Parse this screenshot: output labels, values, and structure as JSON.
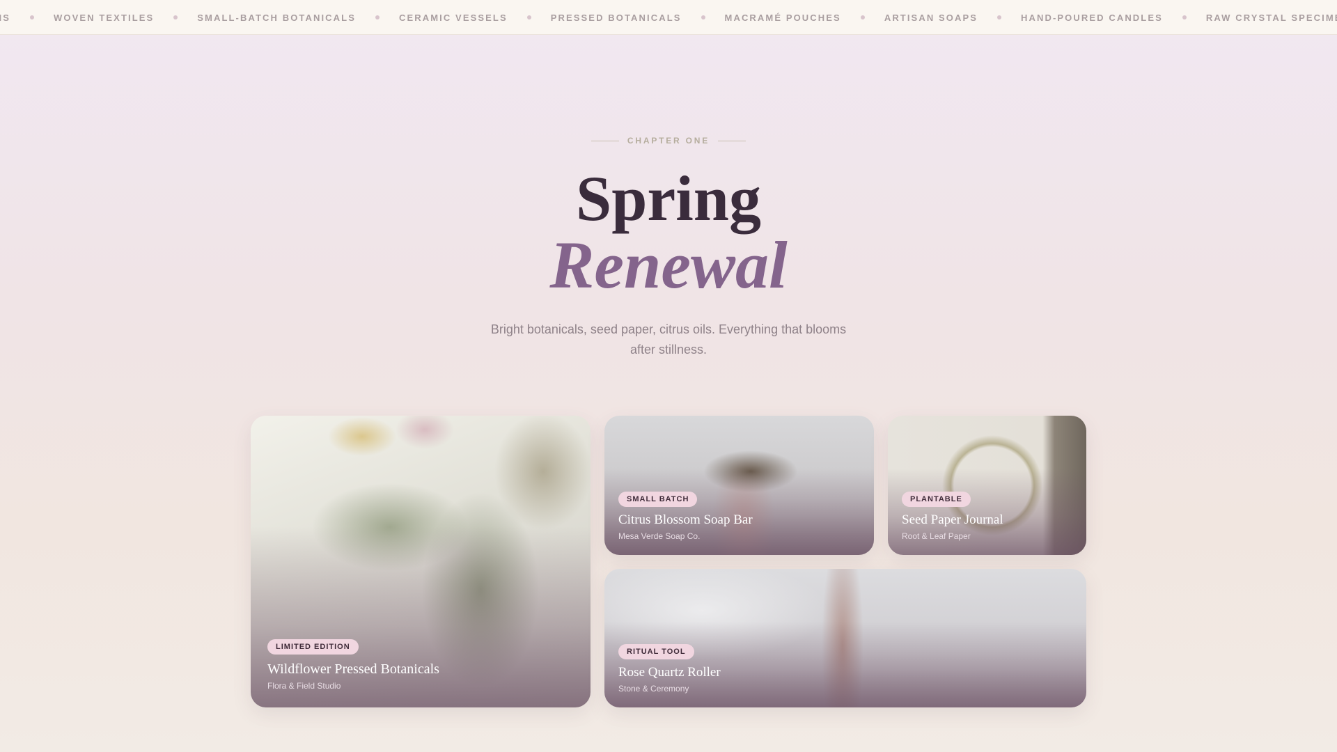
{
  "ticker": {
    "items": [
      "ENS",
      "WOVEN TEXTILES",
      "SMALL-BATCH BOTANICALS",
      "CERAMIC VESSELS",
      "PRESSED BOTANICALS",
      "MACRAMÉ POUCHES",
      "ARTISAN SOAPS",
      "HAND-POURED CANDLES",
      "RAW CRYSTAL SPECIMENS"
    ]
  },
  "hero": {
    "eyebrow": "CHAPTER ONE",
    "title_line1": "Spring",
    "title_line2": "Renewal",
    "subtitle": "Bright botanicals, seed paper, citrus oils. Everything that blooms after stillness."
  },
  "cards": [
    {
      "badge": "LIMITED EDITION",
      "title": "Wildflower Pressed Botanicals",
      "maker": "Flora & Field Studio"
    },
    {
      "badge": "SMALL BATCH",
      "title": "Citrus Blossom Soap Bar",
      "maker": "Mesa Verde Soap Co."
    },
    {
      "badge": "PLANTABLE",
      "title": "Seed Paper Journal",
      "maker": "Root & Leaf Paper"
    },
    {
      "badge": "RITUAL TOOL",
      "title": "Rose Quartz Roller",
      "maker": "Stone & Ceremony"
    }
  ],
  "colors": {
    "accent": "#84648c",
    "heading": "#3a2c3c",
    "badge_bg": "#f1d6e0"
  }
}
